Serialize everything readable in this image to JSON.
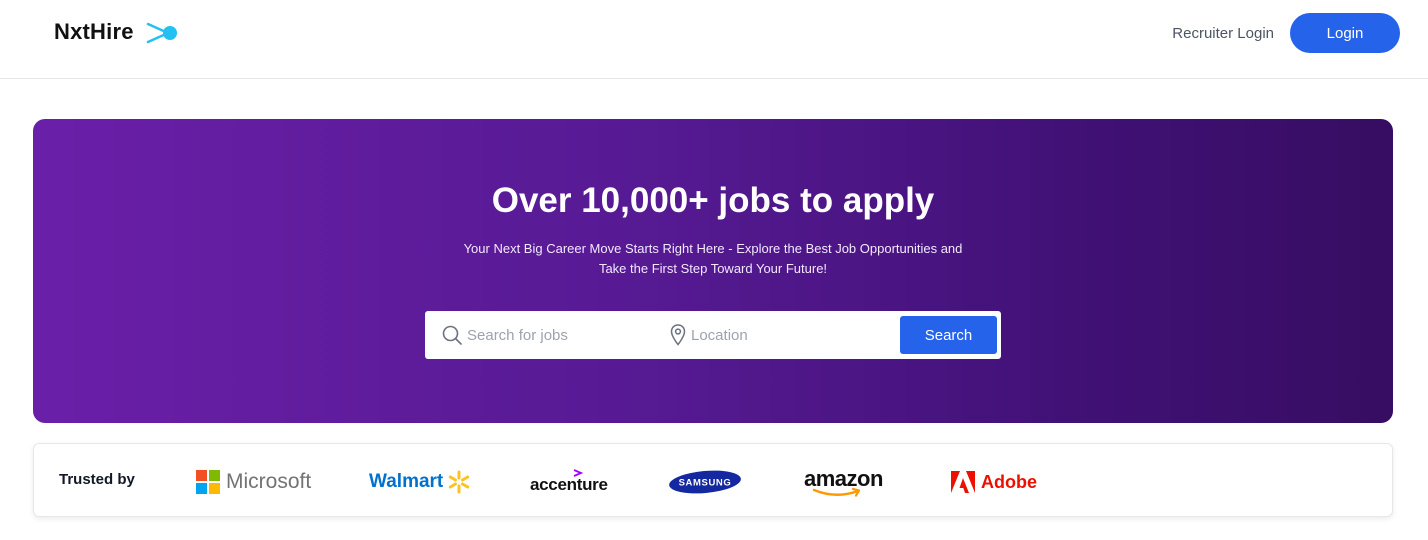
{
  "header": {
    "brand": "NxtHire",
    "recruiter_login": "Recruiter Login",
    "login": "Login"
  },
  "hero": {
    "title": "Over 10,000+ jobs to apply",
    "subtitle_line1": "Your Next Big Career Move Starts Right Here - Explore the Best Job Opportunities and",
    "subtitle_line2": "Take the First Step Toward Your Future!",
    "search": {
      "job_placeholder": "Search for jobs",
      "location_placeholder": "Location",
      "button_label": "Search"
    }
  },
  "trusted": {
    "label": "Trusted by",
    "companies": [
      {
        "name": "Microsoft",
        "icon": "microsoft-logo"
      },
      {
        "name": "Walmart",
        "icon": "walmart-logo"
      },
      {
        "name": "accenture",
        "icon": "accenture-logo"
      },
      {
        "name": "SAMSUNG",
        "icon": "samsung-logo"
      },
      {
        "name": "amazon",
        "icon": "amazon-logo"
      },
      {
        "name": "Adobe",
        "icon": "adobe-logo"
      }
    ]
  },
  "colors": {
    "accent": "#2563eb",
    "hero_gradient_start": "#6a1fa8",
    "hero_gradient_end": "#360d62",
    "brand_mark": "#22c1f1"
  }
}
